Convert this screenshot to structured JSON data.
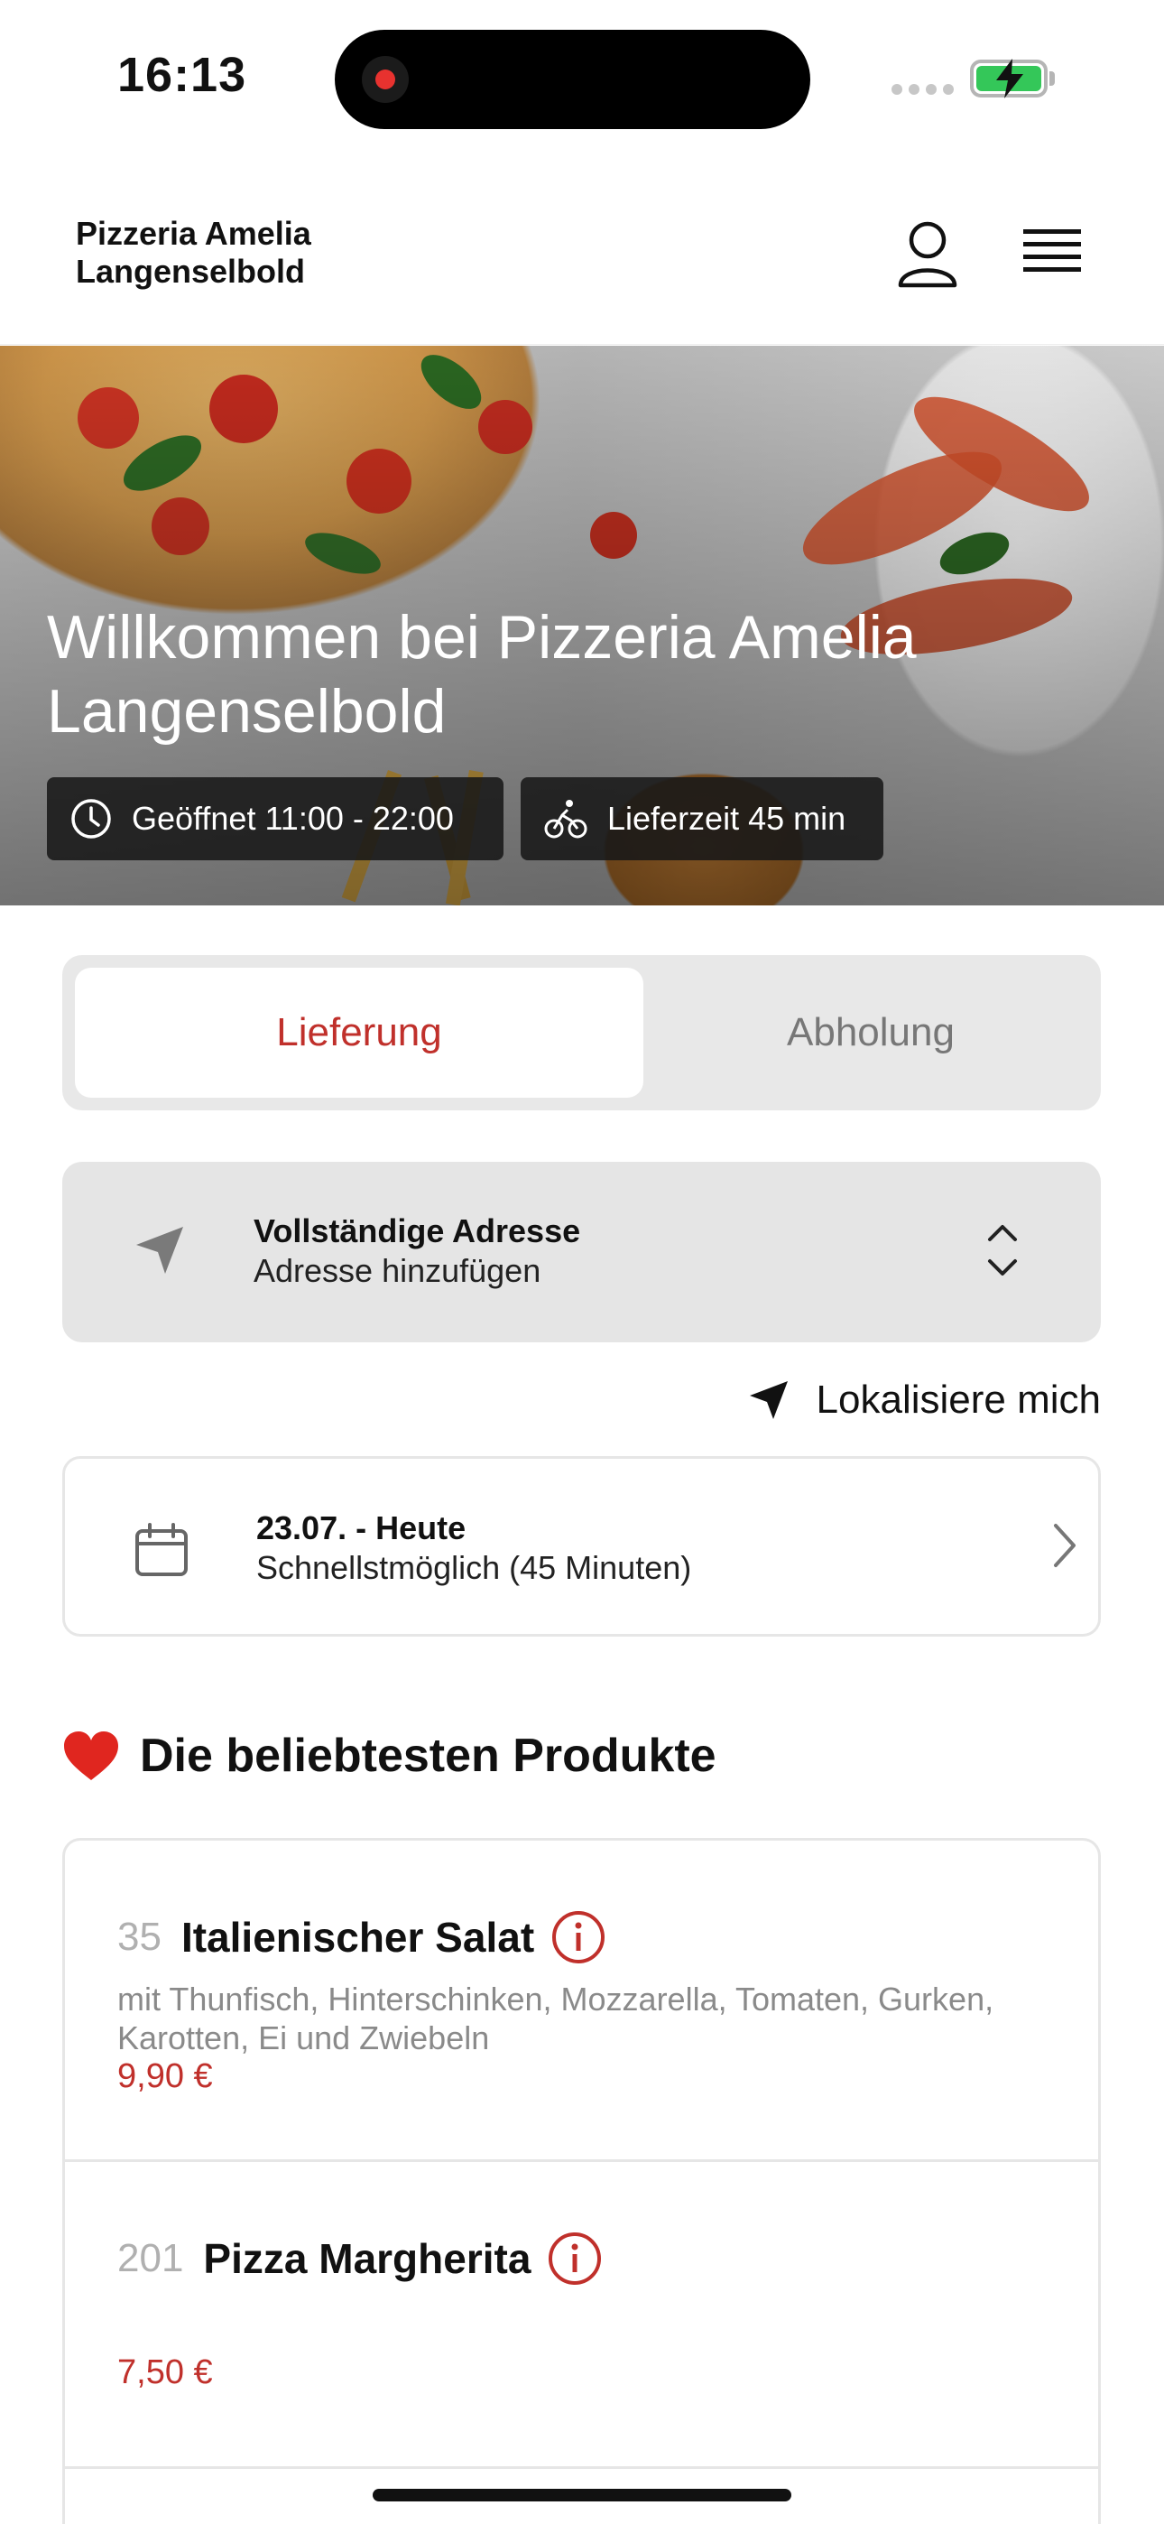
{
  "status_bar": {
    "time": "16:13"
  },
  "header": {
    "brand_line1": "Pizzeria Amelia",
    "brand_line2": "Langenselbold"
  },
  "hero": {
    "title_line1": "Willkommen bei Pizzeria Amelia",
    "title_line2": "Langenselbold",
    "opening_hours": "Geöffnet 11:00 - 22:00",
    "delivery_time": "Lieferzeit 45 min"
  },
  "order_mode": {
    "delivery_label": "Lieferung",
    "pickup_label": "Abholung",
    "selected": "delivery"
  },
  "address": {
    "title": "Vollständige Adresse",
    "subtitle": "Adresse hinzufügen"
  },
  "locate_label": "Lokalisiere mich",
  "schedule": {
    "title": "23.07. - Heute",
    "subtitle": "Schnellstmöglich (45 Minuten)"
  },
  "popular": {
    "heading": "Die beliebtesten Produkte",
    "products": [
      {
        "number": "35",
        "name": "Italienischer Salat",
        "description": "mit Thunfisch, Hinterschinken, Mozzarella, Tomaten, Gurken, Karotten, Ei und Zwiebeln",
        "price": "9,90 €"
      },
      {
        "number": "201",
        "name": "Pizza Margherita",
        "description": "",
        "price": "7,50 €"
      }
    ]
  },
  "colors": {
    "accent": "#c0302b",
    "segment_bg": "#e8e8e8",
    "address_bg": "#e5e5e5",
    "battery": "#34c759"
  },
  "icons": [
    "clock-icon",
    "bicycle-icon",
    "user-icon",
    "menu-icon",
    "navigation-arrow-icon",
    "chevron-up-down-icon",
    "calendar-icon",
    "chevron-right-icon",
    "heart-icon",
    "info-icon"
  ]
}
